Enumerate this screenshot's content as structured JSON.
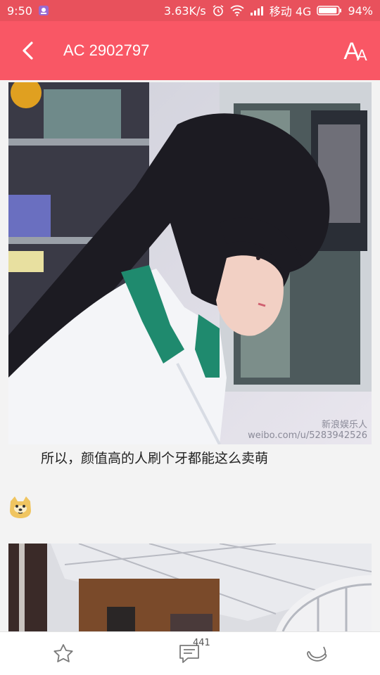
{
  "status": {
    "time": "9:50",
    "net_speed": "3.63K/s",
    "carrier": "移动 4G",
    "battery": "94%",
    "battery_level": 0.94
  },
  "header": {
    "title": "AC 2902797",
    "font_big": "A",
    "font_small": "A",
    "bg_color": "#f95765"
  },
  "post": {
    "caption": "所以，颜值高的人刷个牙都能这么卖萌",
    "watermark_line1": "新浪娱乐人",
    "watermark_line2": "weibo.com/u/5283942526"
  },
  "toolbar": {
    "comment_count": "441"
  }
}
